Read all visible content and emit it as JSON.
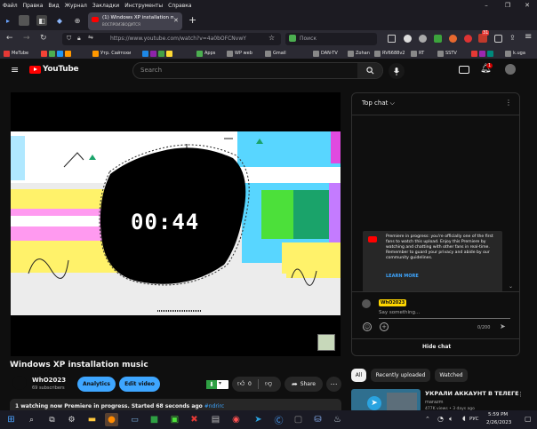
{
  "browser": {
    "menu": [
      "Файл",
      "Правка",
      "Вид",
      "Журнал",
      "Закладки",
      "Инструменты",
      "Справка"
    ],
    "window_controls": [
      "–",
      "❐",
      "✕"
    ],
    "active_tab": {
      "title": "(1) Windows XP installation mu",
      "subtitle": "ВОСПРОИЗВОДИТСЯ"
    },
    "url": "https://www.youtube.com/watch?v=4a0bOFCNvwY",
    "search_placeholder": "Поиск",
    "notif_count": "31",
    "bookmarks": [
      {
        "label": "MeTube",
        "color": "#e53935"
      },
      {
        "label": "Утр. Сайтохи",
        "color": "#ff9800"
      },
      {
        "label": "Apps",
        "color": "#4caf50"
      },
      {
        "label": "WP web",
        "color": "#888888"
      },
      {
        "label": "Gmail",
        "color": "#888888"
      },
      {
        "label": "DAN-TV",
        "color": "#888888"
      },
      {
        "label": "Zohan",
        "color": "#888888"
      },
      {
        "label": "RV6688v2",
        "color": "#888888"
      },
      {
        "label": "RT",
        "color": "#888888"
      },
      {
        "label": "SSTV",
        "color": "#888888"
      },
      {
        "label": "k.uga",
        "color": "#888888"
      }
    ]
  },
  "youtube": {
    "logo_text": "YouTube",
    "search_placeholder": "Search",
    "notif_badge": "1",
    "timer": "00:44",
    "video_title": "Windows XP installation music",
    "channel": {
      "name": "WhO2023",
      "subscribers": "69 subscribers"
    },
    "buttons": {
      "analytics": "Analytics",
      "edit_video": "Edit video",
      "like_count": "0",
      "share": "Share"
    },
    "status_line_bold": "1 watching now  Premiere in progress. Started 68 seconds ago",
    "status_line_tag": " #ndrirc",
    "chat": {
      "header": "Top chat",
      "premiere_message": "Premiere in progress: you're officially one of the first fans to watch this upload. Enjoy this Premiere by watching and chatting with other fans in real-time. Remember to guard your privacy and abide by our community guidelines.",
      "learn_more": "LEARN MORE",
      "user_badge": "WhO2023",
      "input_placeholder": "Say something...",
      "char_count": "0/200",
      "hide_chat": "Hide chat"
    },
    "filter_chips": [
      "All",
      "Recently uploaded",
      "Watched"
    ],
    "recommended": {
      "title": "УКРАЛИ АККАУНТ В ТЕЛЕГЕ",
      "channel": "marazm",
      "meta": "477K views • 3 days ago"
    }
  },
  "taskbar": {
    "lang": "РУС",
    "time": "5:59 PM",
    "date": "2/26/2023"
  }
}
